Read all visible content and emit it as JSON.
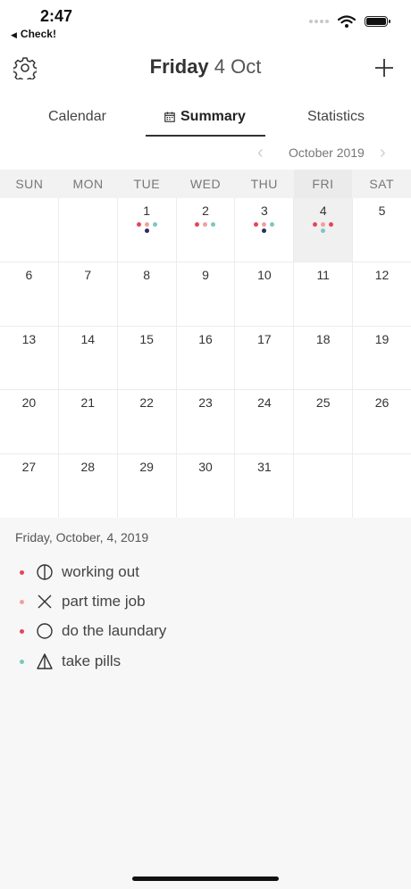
{
  "status_bar": {
    "time": "2:47",
    "back_label": "Check!"
  },
  "header": {
    "title_day": "Friday",
    "title_rest": " 4 Oct"
  },
  "tabs": [
    {
      "label": "Calendar"
    },
    {
      "label": "Summary",
      "selected": true
    },
    {
      "label": "Statistics"
    }
  ],
  "month_nav": {
    "label": "October 2019",
    "prev": "‹",
    "next": "›"
  },
  "weekdays": [
    "SUN",
    "MON",
    "TUE",
    "WED",
    "THU",
    "FRI",
    "SAT"
  ],
  "colors": {
    "red": "#e8445a",
    "pink": "#f0a0a0",
    "teal": "#7cc7bf",
    "navy": "#2b2d5c"
  },
  "calendar": {
    "rows": [
      [
        {
          "day": ""
        },
        {
          "day": ""
        },
        {
          "day": "1",
          "dots": [
            "red",
            "pink",
            "teal"
          ],
          "dots2": [
            "navy"
          ]
        },
        {
          "day": "2",
          "dots": [
            "red",
            "pink",
            "teal"
          ]
        },
        {
          "day": "3",
          "dots": [
            "red",
            "pink",
            "teal"
          ],
          "dots2": [
            "navy"
          ]
        },
        {
          "day": "4",
          "dots": [
            "red",
            "pink",
            "red"
          ],
          "dots2": [
            "teal"
          ],
          "selected": true
        },
        {
          "day": "5"
        }
      ],
      [
        {
          "day": "6"
        },
        {
          "day": "7"
        },
        {
          "day": "8"
        },
        {
          "day": "9"
        },
        {
          "day": "10"
        },
        {
          "day": "11"
        },
        {
          "day": "12"
        }
      ],
      [
        {
          "day": "13"
        },
        {
          "day": "14"
        },
        {
          "day": "15"
        },
        {
          "day": "16"
        },
        {
          "day": "17"
        },
        {
          "day": "18"
        },
        {
          "day": "19"
        }
      ],
      [
        {
          "day": "20"
        },
        {
          "day": "21"
        },
        {
          "day": "22"
        },
        {
          "day": "23"
        },
        {
          "day": "24"
        },
        {
          "day": "25"
        },
        {
          "day": "26"
        }
      ],
      [
        {
          "day": "27"
        },
        {
          "day": "28"
        },
        {
          "day": "29"
        },
        {
          "day": "30"
        },
        {
          "day": "31"
        },
        {
          "day": ""
        },
        {
          "day": ""
        }
      ]
    ]
  },
  "detail": {
    "date": "Friday, October, 4, 2019",
    "tasks": [
      {
        "label": "working out",
        "icon": "half-circle-icon",
        "color": "red"
      },
      {
        "label": "part time job",
        "icon": "x-mark-icon",
        "color": "pink"
      },
      {
        "label": "do the laundary",
        "icon": "circle-icon",
        "color": "red"
      },
      {
        "label": "take pills",
        "icon": "half-triangle-icon",
        "color": "teal"
      }
    ]
  }
}
